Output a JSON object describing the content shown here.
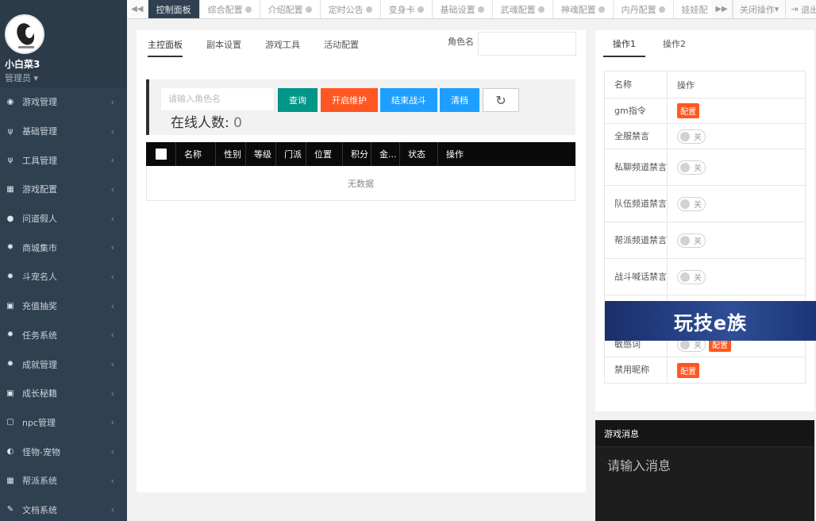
{
  "sidebar": {
    "user": {
      "name": "小白菜3",
      "role": "管理员"
    },
    "items": [
      {
        "label": "游戏管理",
        "icon": "gamepad-icon"
      },
      {
        "label": "基础管理",
        "icon": "fork-knife-icon"
      },
      {
        "label": "工具管理",
        "icon": "fork-knife-icon"
      },
      {
        "label": "游戏配置",
        "icon": "grid-icon"
      },
      {
        "label": "问道假人",
        "icon": "user-icon"
      },
      {
        "label": "商城集市",
        "icon": "gear-icon"
      },
      {
        "label": "斗宠名人",
        "icon": "gear-icon"
      },
      {
        "label": "充值抽奖",
        "icon": "card-icon"
      },
      {
        "label": "任务系统",
        "icon": "gear-icon"
      },
      {
        "label": "成就管理",
        "icon": "gear-icon"
      },
      {
        "label": "成长秘籍",
        "icon": "card-icon"
      },
      {
        "label": "npc管理",
        "icon": "square-icon"
      },
      {
        "label": "怪物-宠物",
        "icon": "half-circle-icon"
      },
      {
        "label": "帮派系统",
        "icon": "grid-icon"
      },
      {
        "label": "文档系统",
        "icon": "book-icon"
      }
    ]
  },
  "topbar": {
    "tabs": [
      {
        "label": "控制面板",
        "active": true,
        "closable": false
      },
      {
        "label": "综合配置",
        "closable": true
      },
      {
        "label": "介绍配置",
        "closable": true
      },
      {
        "label": "定时公告",
        "closable": true
      },
      {
        "label": "变身卡",
        "closable": true
      },
      {
        "label": "基础设置",
        "closable": true
      },
      {
        "label": "武魂配置",
        "closable": true
      },
      {
        "label": "神魂配置",
        "closable": true
      },
      {
        "label": "内丹配置",
        "closable": true
      },
      {
        "label": "娃娃配",
        "closable": false
      }
    ],
    "close_ops": "关闭操作",
    "exit": "退出"
  },
  "main": {
    "subtabs": [
      "主控面板",
      "副本设置",
      "游戏工具",
      "活动配置"
    ],
    "role_label": "角色名",
    "search_placeholder": "请输入角色名",
    "buttons": {
      "query": "查询",
      "maintenance": "开启维护",
      "end_battle": "结束战斗",
      "clear": "清档"
    },
    "online_label": "在线人数:",
    "online_count": "0",
    "columns": [
      "名称",
      "性别",
      "等级",
      "门派",
      "位置",
      "积分",
      "金...",
      "状态",
      "操作"
    ],
    "empty_text": "无数据"
  },
  "right": {
    "tabs": [
      "操作1",
      "操作2"
    ],
    "head": {
      "name": "名称",
      "action": "操作"
    },
    "config_label": "配置",
    "off_label": "关",
    "rows": [
      {
        "name": "gm指令",
        "switch": false,
        "config": true
      },
      {
        "name": "全服禁言",
        "switch": true,
        "config": false
      },
      {
        "name": "私聊频道禁言",
        "switch": true,
        "config": false
      },
      {
        "name": "队伍频道禁言",
        "switch": true,
        "config": false
      },
      {
        "name": "帮派频道禁言",
        "switch": true,
        "config": false
      },
      {
        "name": "战斗喊话禁言",
        "switch": true,
        "config": false
      },
      {
        "name": "",
        "switch": false,
        "config": false
      },
      {
        "name": "敏感词",
        "switch": true,
        "config": true
      },
      {
        "name": "禁用昵称",
        "switch": false,
        "config": true
      }
    ]
  },
  "banner": {
    "text": "玩技e族"
  },
  "message": {
    "title": "游戏消息",
    "placeholder": "请输入消息"
  }
}
